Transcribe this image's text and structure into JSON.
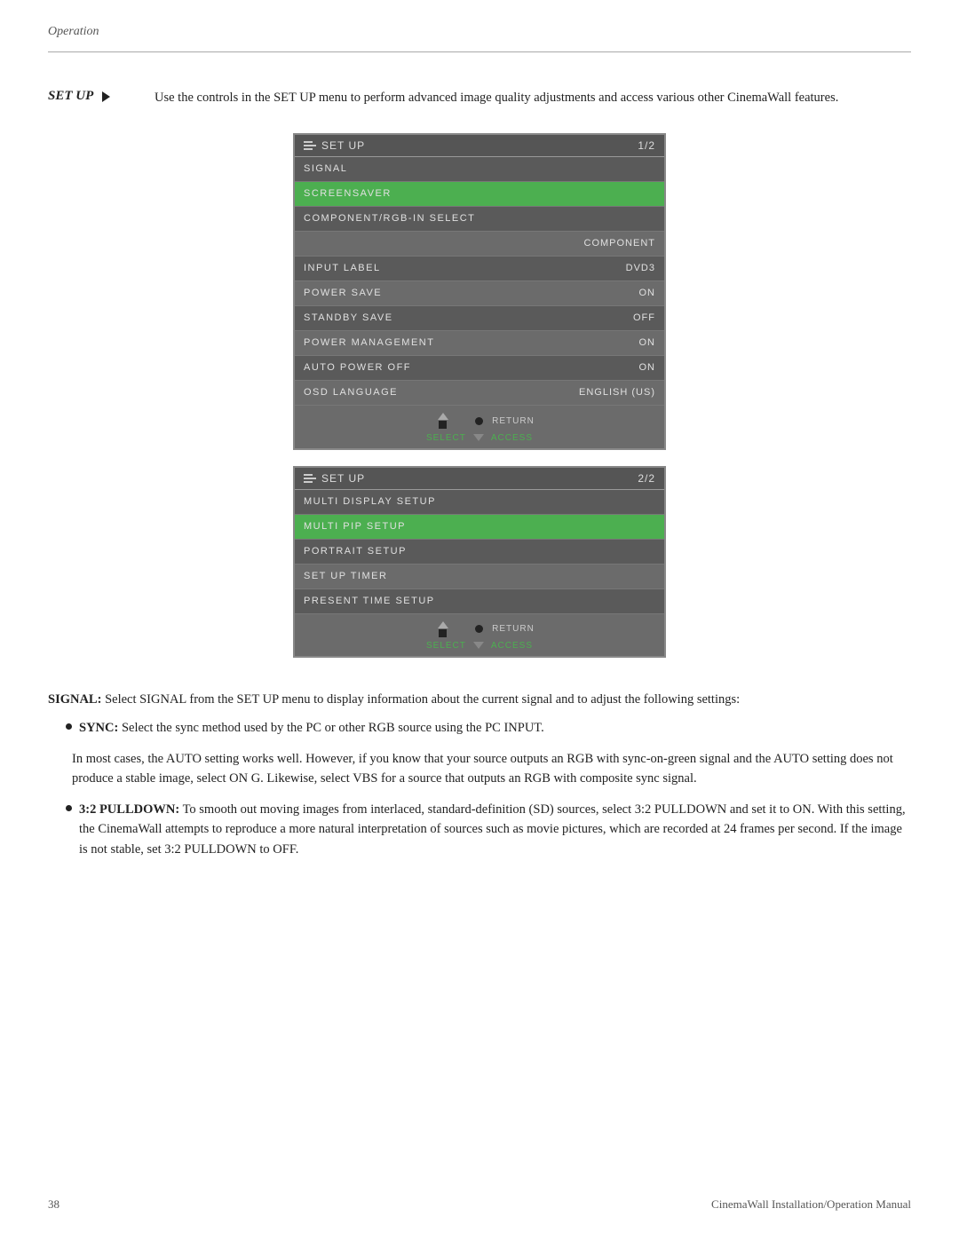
{
  "header": {
    "section": "Operation"
  },
  "setup_intro": {
    "label": "SET UP",
    "description": "Use the controls in the SET UP menu to perform advanced image quality adjustments and access various other CinemaWall features."
  },
  "menu1": {
    "title": "SET UP",
    "page": "1/2",
    "rows": [
      {
        "label": "SIGNAL",
        "value": "",
        "style": "dark"
      },
      {
        "label": "SCREENSAVER",
        "value": "",
        "style": "active"
      },
      {
        "label": "COMPONENT/RGB-IN SELECT",
        "value": "",
        "style": "dark"
      },
      {
        "label": "",
        "value": "COMPONENT",
        "style": "medium"
      },
      {
        "label": "INPUT LABEL",
        "value": "DVD3",
        "style": "dark"
      },
      {
        "label": "POWER SAVE",
        "value": "ON",
        "style": "medium"
      },
      {
        "label": "STANDBY SAVE",
        "value": "OFF",
        "style": "dark"
      },
      {
        "label": "POWER MANAGEMENT",
        "value": "ON",
        "style": "medium"
      },
      {
        "label": "AUTO POWER OFF",
        "value": "ON",
        "style": "dark"
      },
      {
        "label": "OSD LANGUAGE",
        "value": "ENGLISH (US)",
        "style": "medium"
      }
    ],
    "nav": {
      "return": "RETURN",
      "select": "SELECT",
      "access": "ACCESS"
    }
  },
  "menu2": {
    "title": "SET UP",
    "page": "2/2",
    "rows": [
      {
        "label": "MULTI DISPLAY SETUP",
        "value": "",
        "style": "dark"
      },
      {
        "label": "MULTI PIP SETUP",
        "value": "",
        "style": "active"
      },
      {
        "label": "PORTRAIT SETUP",
        "value": "",
        "style": "dark"
      },
      {
        "label": "SET UP TIMER",
        "value": "",
        "style": "medium"
      },
      {
        "label": "PRESENT TIME SETUP",
        "value": "",
        "style": "dark"
      }
    ],
    "nav": {
      "return": "RETURN",
      "select": "SELECT",
      "access": "ACCESS"
    }
  },
  "body": {
    "signal_intro": "SIGNAL: Select SIGNAL from the SET UP menu to display information about the current signal and to adjust the following settings:",
    "bullets": [
      {
        "term": "SYNC:",
        "text": " Select the sync method used by the PC or other RGB source using the PC INPUT."
      },
      {
        "term": "3:2 PULLDOWN:",
        "text": " To smooth out moving images from interlaced, standard-definition (SD) sources, select 3:2 PULLDOWN and set it to ON. With this setting, the CinemaWall attempts to reproduce a more natural interpretation of sources such as movie pictures, which are recorded at 24 frames per second. If the image is not stable, set 3:2 PULLDOWN to OFF."
      }
    ],
    "sync_paragraph": "In most cases, the AUTO setting works well. However, if you know that your source outputs an RGB with sync-on-green signal and the AUTO setting does not produce a stable image, select ON G. Likewise, select VBS for a source that outputs an RGB with composite sync signal."
  },
  "footer": {
    "page_number": "38",
    "manual_title": "CinemaWall Installation/Operation Manual"
  }
}
